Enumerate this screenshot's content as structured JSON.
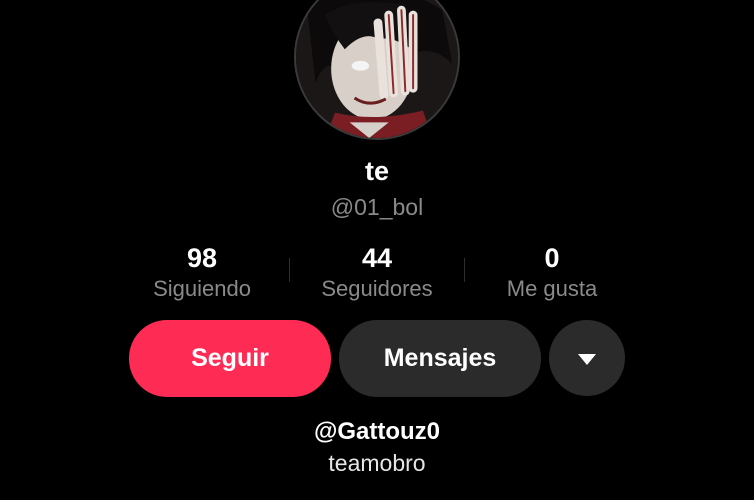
{
  "profile": {
    "display_name": "te",
    "username": "@01_bol"
  },
  "stats": [
    {
      "value": "98",
      "label": "Siguiendo"
    },
    {
      "value": "44",
      "label": "Seguidores"
    },
    {
      "value": "0",
      "label": "Me gusta"
    }
  ],
  "actions": {
    "follow_label": "Seguir",
    "message_label": "Mensajes",
    "more_icon": "caret-down-icon"
  },
  "bio": {
    "mention": "@Gattouz0",
    "text": "teamobro"
  },
  "colors": {
    "background": "#000000",
    "follow_button": "#fe2c55",
    "secondary_button": "#2b2b2b",
    "muted_text": "#8a8a8a"
  }
}
